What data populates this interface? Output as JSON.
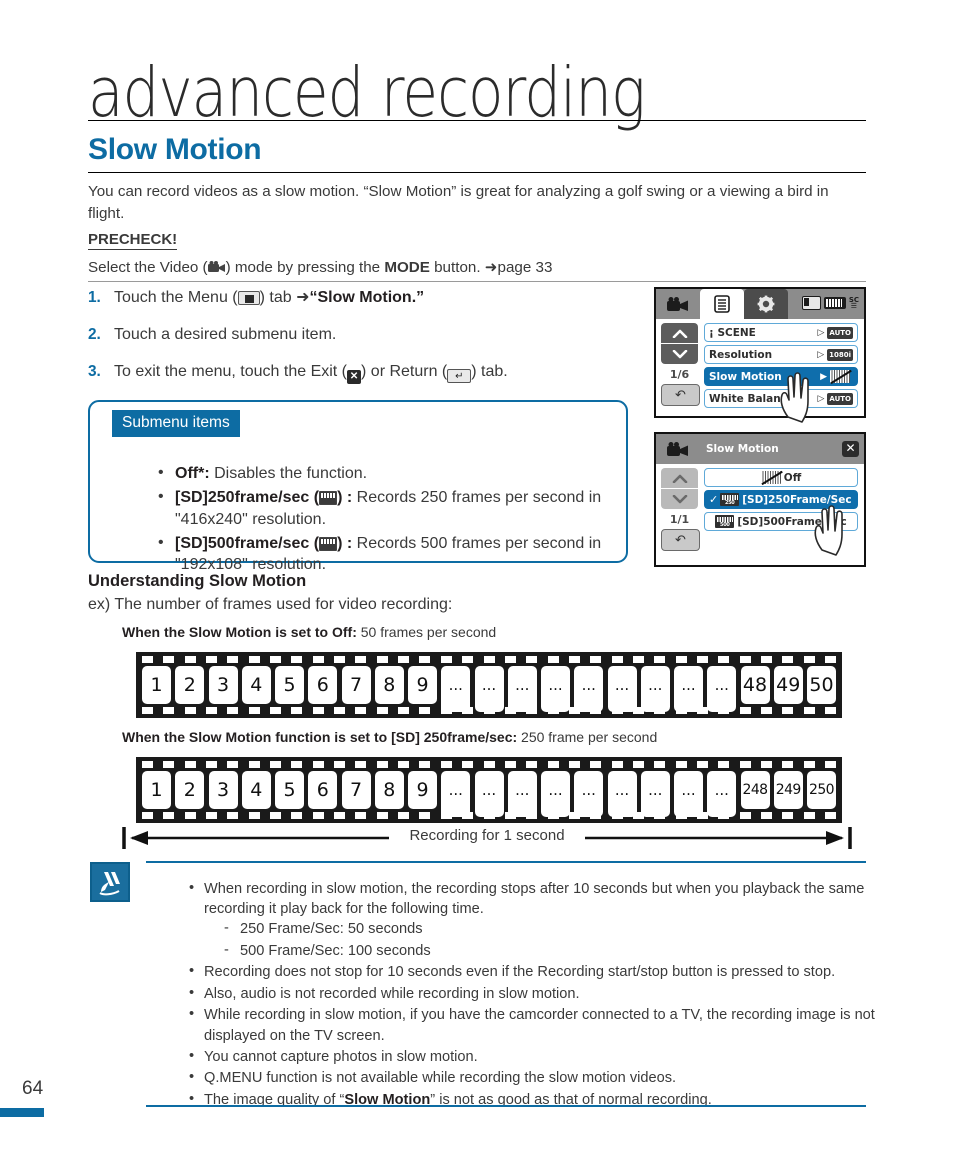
{
  "chapter": {
    "title": "advanced recording"
  },
  "section": {
    "title": "Slow Motion"
  },
  "intro": "You can record videos as a slow motion. “Slow Motion” is great for analyzing a golf swing or a viewing a bird in flight.",
  "precheck": {
    "label": "PRECHECK!",
    "text_before": "Select the Video (",
    "text_mid": ") mode by pressing the ",
    "bold": "MODE",
    "text_after": " button. ➜page 33"
  },
  "steps": [
    {
      "num": "1.",
      "pre": "Touch the Menu (",
      "mid": ") tab ➜",
      "bold": "“Slow Motion.”",
      "post": ""
    },
    {
      "num": "2.",
      "pre": "Touch a desired submenu item.",
      "mid": "",
      "bold": "",
      "post": ""
    },
    {
      "num": "3.",
      "pre": "To exit the menu, touch the Exit (",
      "mid": ") or Return (",
      "bold": "",
      "post": ") tab."
    }
  ],
  "submenu": {
    "badge": "Submenu items",
    "items": [
      {
        "name": "Off*:",
        "desc": " Disables the function."
      },
      {
        "name": "[SD]250frame/sec (",
        "name2": ") :",
        "desc": " Records 250 frames per second in \"416x240\" resolution."
      },
      {
        "name": "[SD]500frame/sec (",
        "name2": ") :",
        "desc": " Records 500 frames per second in \"192x108\" resolution."
      }
    ]
  },
  "lcd_top": {
    "tabs": [
      "camcorder-icon",
      "menu-icon",
      "gear-icon"
    ],
    "status": {
      "card": "card-icon",
      "battery": "battery-icon",
      "sc": "SC"
    },
    "page_indicator": "1/6",
    "rows": [
      {
        "label": "¡ SCENE",
        "badge": "AUTO",
        "selected": false
      },
      {
        "label": "Resolution",
        "badge": "1080i",
        "selected": false
      },
      {
        "label": "Slow Motion",
        "badge": "SLOW-OFF",
        "selected": true
      },
      {
        "label": "White Balance",
        "badge": "AUTO",
        "selected": false
      }
    ]
  },
  "lcd_bottom": {
    "title": "Slow Motion",
    "close": "✕",
    "page_indicator": "1/1",
    "rows": [
      {
        "label": "Off",
        "selected": false,
        "checked": false,
        "icon": "slow-off-icon"
      },
      {
        "label": "[SD]250Frame/Sec",
        "selected": true,
        "checked": true,
        "icon": "fps250-icon",
        "badge_text": "250"
      },
      {
        "label": "[SD]500Frame/Sec",
        "selected": false,
        "checked": false,
        "icon": "fps500-icon",
        "badge_text": "500"
      }
    ]
  },
  "understanding": {
    "title": "Understanding Slow Motion",
    "ex": "ex) The number of frames used for video recording:",
    "caption1_bold": "When the Slow Motion is set to Off:",
    "caption1_rest": " 50 frames per second",
    "caption2_bold": "When the Slow Motion function is set to [SD] 250frame/sec:",
    "caption2_rest": " 250 frame per second",
    "recording_label": "Recording for 1 second"
  },
  "chart_data": {
    "type": "table",
    "title": "Frames used for video recording",
    "series": [
      {
        "name": "Slow Motion Off — 50 frames per second",
        "frames": [
          "1",
          "2",
          "3",
          "4",
          "5",
          "6",
          "7",
          "8",
          "9",
          "...",
          "...",
          "...",
          "...",
          "...",
          "...",
          "...",
          "...",
          "...",
          "48",
          "49",
          "50"
        ],
        "total_frames": 50,
        "duration_label": "Recording for 1 second"
      },
      {
        "name": "[SD] 250frame/sec — 250 frame per second",
        "frames": [
          "1",
          "2",
          "3",
          "4",
          "5",
          "6",
          "7",
          "8",
          "9",
          "...",
          "...",
          "...",
          "...",
          "...",
          "...",
          "...",
          "...",
          "...",
          "248",
          "249",
          "250"
        ],
        "total_frames": 250,
        "duration_label": "Recording for 1 second"
      }
    ]
  },
  "notes": [
    {
      "text": "When recording in slow motion, the recording stops after 10 seconds but when you playback the same recording it play back for the following time.",
      "sub": [
        "250 Frame/Sec: 50 seconds",
        "500 Frame/Sec: 100 seconds"
      ]
    },
    {
      "text": "Recording does not stop for 10 seconds even if the Recording start/stop button is pressed to stop.",
      "sub": []
    },
    {
      "text": "Also, audio is not recorded while recording in slow motion.",
      "sub": []
    },
    {
      "text": "While recording in slow motion, if you have the camcorder connected to a TV, the recording image is not displayed on the TV screen.",
      "sub": []
    },
    {
      "text": "You cannot capture photos in slow motion.",
      "sub": []
    },
    {
      "text": "Q.MENU function is not available while recording the slow motion videos.",
      "sub": []
    },
    {
      "text_pre": "The image quality of “",
      "text_bold": "Slow Motion",
      "text_post": "” is not as good as that of normal recording.",
      "sub": []
    }
  ],
  "footer": {
    "page_number": "64"
  },
  "colors": {
    "accent": "#0d6ca3",
    "highlight": "#0f6eac",
    "text": "#3a3a3a"
  }
}
